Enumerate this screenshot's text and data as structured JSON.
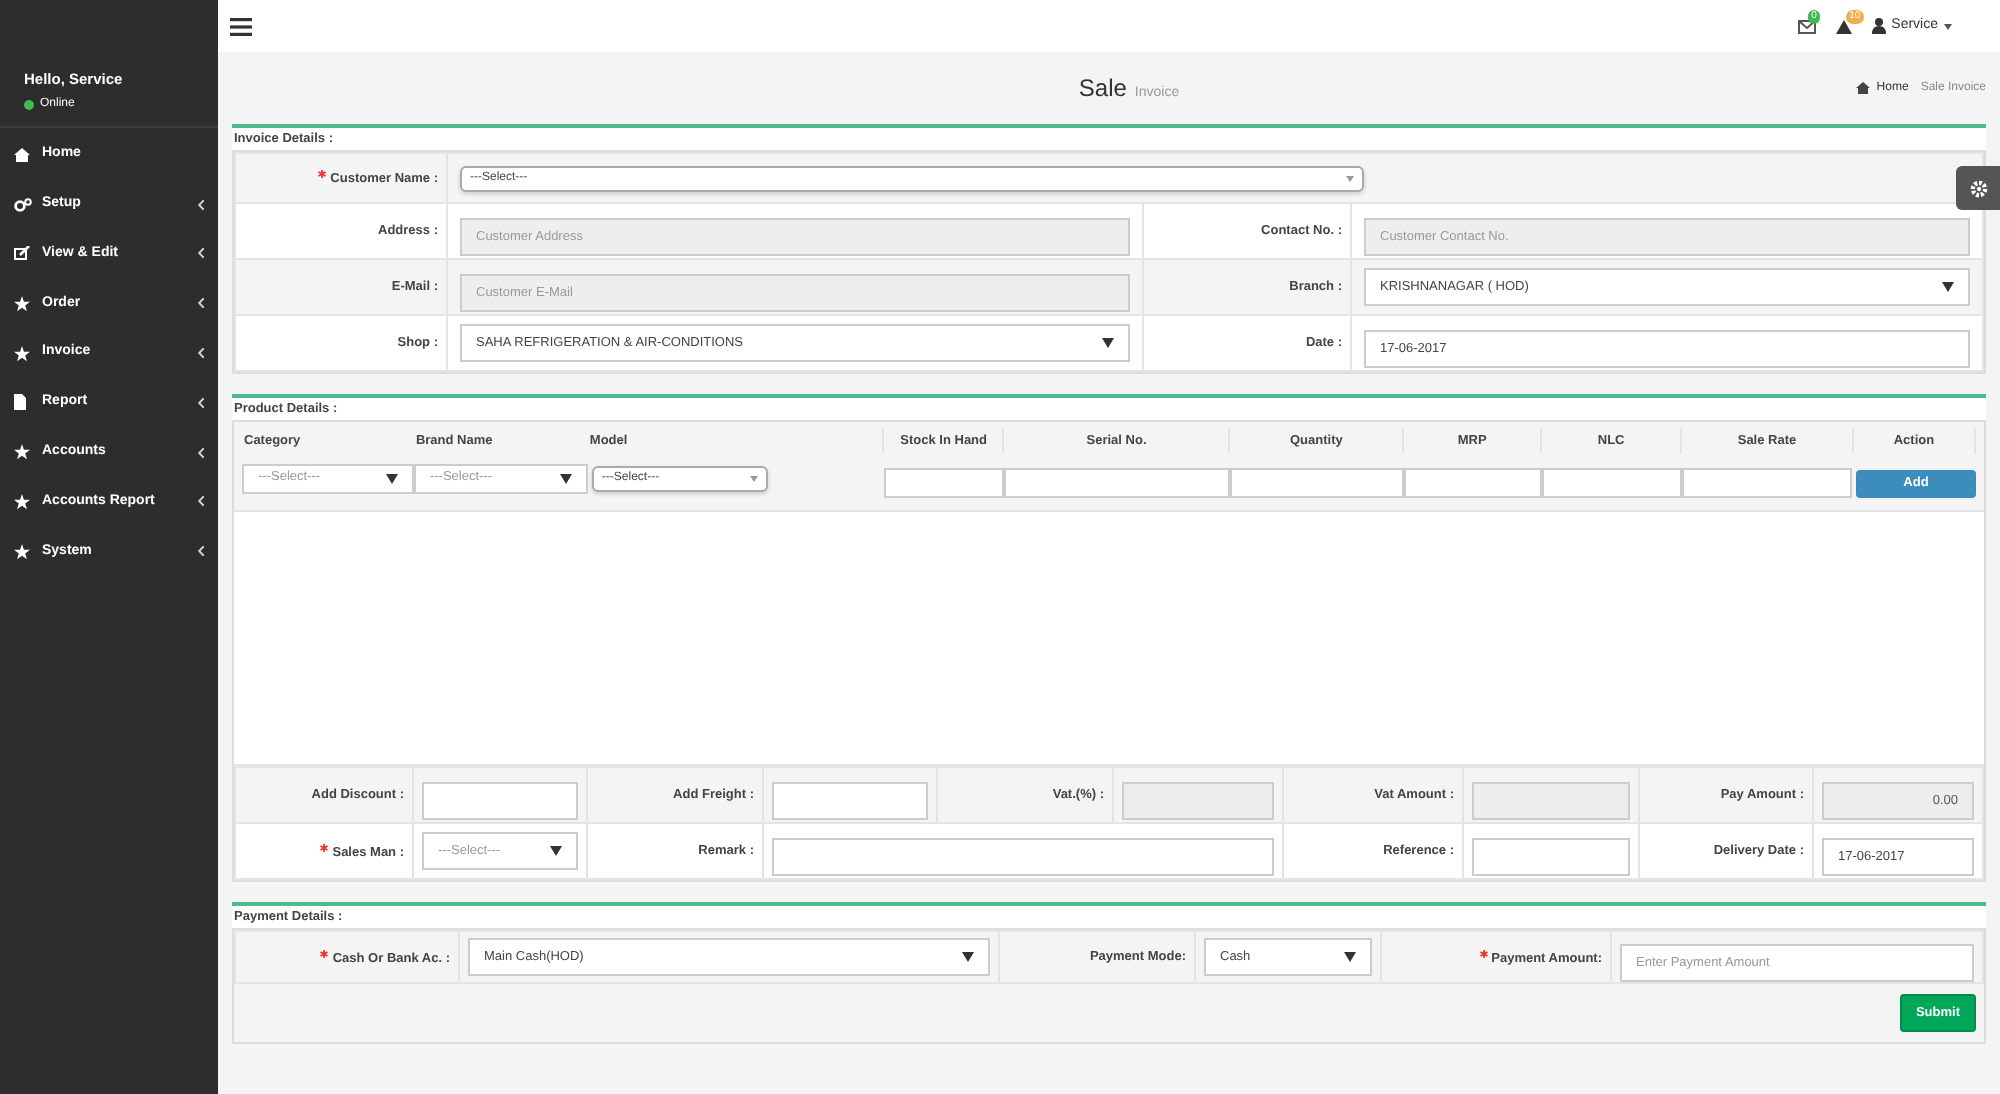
{
  "sidebar": {
    "greeting": "Hello, Service",
    "status": "Online",
    "items": [
      {
        "kind": "home",
        "label": "Home",
        "has_submenu": false
      },
      {
        "kind": "gears",
        "label": "Setup",
        "has_submenu": true
      },
      {
        "kind": "edit",
        "label": "View & Edit",
        "has_submenu": true
      },
      {
        "kind": "star",
        "label": "Order",
        "has_submenu": true
      },
      {
        "kind": "star",
        "label": "Invoice",
        "has_submenu": true
      },
      {
        "kind": "file",
        "label": "Report",
        "has_submenu": true
      },
      {
        "kind": "star",
        "label": "Accounts",
        "has_submenu": true
      },
      {
        "kind": "star",
        "label": "Accounts Report",
        "has_submenu": true
      },
      {
        "kind": "star",
        "label": "System",
        "has_submenu": true
      }
    ]
  },
  "topbar": {
    "messages_badge": "0",
    "alerts_badge": "10",
    "user": "Service"
  },
  "page": {
    "title": "Sale",
    "subtitle": "Invoice",
    "breadcrumb": [
      "Home",
      "Sale Invoice"
    ]
  },
  "invoice_details": {
    "heading": "Invoice Details :",
    "rows": [
      [
        {
          "label": "Customer Name :",
          "required": true,
          "kind": "combo",
          "value": "---Select---"
        }
      ],
      [
        {
          "label": "Address :",
          "required": false,
          "kind": "readonly",
          "placeholder": "Customer Address"
        },
        {
          "label": "Contact No. :",
          "required": false,
          "kind": "readonly",
          "placeholder": "Customer Contact No."
        }
      ],
      [
        {
          "label": "E-Mail :",
          "required": false,
          "kind": "readonly",
          "placeholder": "Customer E-Mail"
        },
        {
          "label": "Branch :",
          "required": false,
          "kind": "select",
          "value": "KRISHNANAGAR ( HOD)"
        }
      ],
      [
        {
          "label": "Shop :",
          "required": false,
          "kind": "select",
          "value": "SAHA REFRIGERATION & AIR-CONDITIONS"
        },
        {
          "label": "Date :",
          "required": false,
          "kind": "text",
          "value": "17-06-2017"
        }
      ]
    ]
  },
  "product_details": {
    "heading": "Product Details :",
    "columns": [
      {
        "label": "Category",
        "kind": "select",
        "value": "---Select---"
      },
      {
        "label": "Brand Name",
        "kind": "select",
        "value": "---Select---"
      },
      {
        "label": "Model",
        "kind": "combo",
        "value": "---Select---"
      },
      {
        "label": "Stock In Hand",
        "kind": "text"
      },
      {
        "label": "Serial No.",
        "kind": "text"
      },
      {
        "label": "Quantity",
        "kind": "text"
      },
      {
        "label": "MRP",
        "kind": "text"
      },
      {
        "label": "NLC",
        "kind": "text"
      },
      {
        "label": "Sale Rate",
        "kind": "text"
      },
      {
        "label": "Action",
        "kind": "button",
        "value": "Add"
      }
    ],
    "totals": [
      [
        {
          "label": "Add Discount :",
          "required": false,
          "kind": "text"
        },
        {
          "label": "Add Freight :",
          "required": false,
          "kind": "text"
        },
        {
          "label": "Vat.(%) :",
          "required": false,
          "kind": "readonly"
        },
        {
          "label": "Vat Amount :",
          "required": false,
          "kind": "readonly"
        },
        {
          "label": "Pay Amount :",
          "required": false,
          "kind": "readonly",
          "value": "0.00"
        }
      ],
      [
        {
          "label": "Sales Man :",
          "required": true,
          "kind": "select",
          "value": "---Select---"
        },
        {
          "label": "Remark :",
          "required": false,
          "kind": "text"
        },
        {
          "label": "Reference :",
          "required": false,
          "kind": "text"
        },
        {
          "label": "Delivery Date :",
          "required": false,
          "kind": "text",
          "value": "17-06-2017"
        }
      ]
    ]
  },
  "payment_details": {
    "heading": "Payment Details :",
    "fields": [
      {
        "label": "Cash Or Bank Ac. :",
        "required": true,
        "kind": "select",
        "value": "Main Cash(HOD)"
      },
      {
        "label": "Payment Mode:",
        "required": false,
        "kind": "select",
        "value": "Cash"
      },
      {
        "label": "Payment Amount:",
        "required": true,
        "kind": "text",
        "placeholder": "Enter Payment Amount"
      }
    ],
    "submit": "Submit"
  }
}
